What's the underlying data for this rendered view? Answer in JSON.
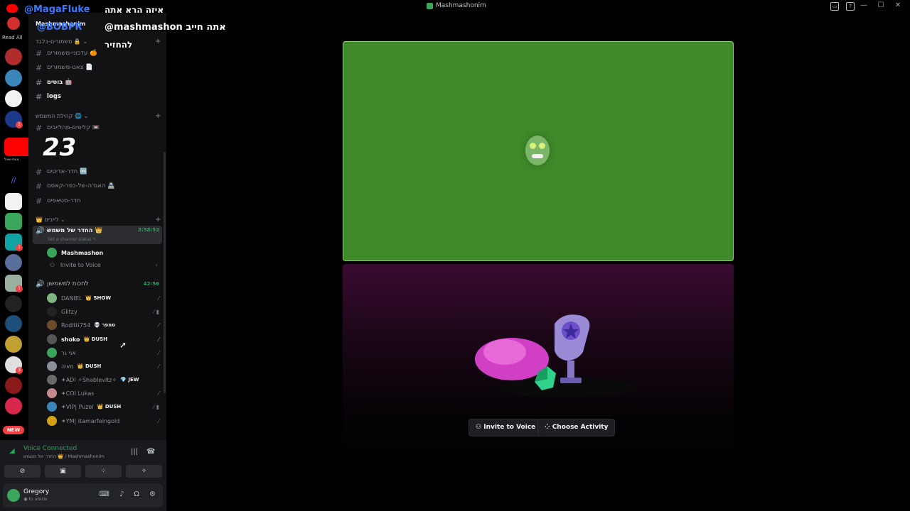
{
  "window": {
    "title": "Mashmashonim"
  },
  "overlay": {
    "line1": "איזה הרא אתה",
    "line2": "@mashmashon אתה חייב",
    "line3": "להחזיר",
    "twitter_handle": "@MagaFluke",
    "twitter_handle2": "@BOBPR",
    "big_number": "23"
  },
  "guilds": {
    "read_all": "Read All",
    "new_badge": "NEW",
    "yt_label": "צוות-שאל"
  },
  "server": {
    "name": "Mashmashonim"
  },
  "categories": [
    {
      "label": "משמורים-בלבד 🔒"
    },
    {
      "label": "קהילת המשמש 🌐"
    },
    {
      "label": "לייבים"
    }
  ],
  "channels": [
    {
      "label": "עדכוני-משמורים 🍊"
    },
    {
      "label": "צאט-משמורים 📄"
    },
    {
      "label": "בוטים 🤖"
    },
    {
      "label": "logs"
    },
    {
      "label": "קליפים-מהלייבים 📼"
    },
    {
      "label": "חדר-אדיטים 🆒"
    },
    {
      "label": "האגדה-של-כפר-קאסם 🏯"
    },
    {
      "label": "חדר-סטאפים"
    }
  ],
  "voice_channels": [
    {
      "label": "החדר של משמש 👑",
      "time": "3:58:52",
      "status": "Set a channel status"
    },
    {
      "label": "לחכות למשמשון",
      "time": "42:56"
    }
  ],
  "voice_members_1": [
    {
      "name": "Mashmashon"
    }
  ],
  "invite_label": "Invite to Voice",
  "voice_members_2": [
    {
      "name": "DANIEL",
      "tag": "👑 SHOW"
    },
    {
      "name": "Glitzy",
      "tag": ""
    },
    {
      "name": "Roditti754",
      "tag": "💀 סמפר"
    },
    {
      "name": "shoko",
      "tag": "👑 DUSH"
    },
    {
      "name": "אני גר",
      "tag": ""
    },
    {
      "name": "מאיה",
      "tag": "👑 DUSH"
    },
    {
      "name": "✦ADI ✧Shablevitz✧",
      "tag": "💎 JEW"
    },
    {
      "name": "✦COI Lukas",
      "tag": ""
    },
    {
      "name": "✦VIP| Puzel",
      "tag": "👑 DUSH"
    },
    {
      "name": "✦YM| itamarfeingold",
      "tag": ""
    }
  ],
  "voice_panel": {
    "connected": "Voice Connected",
    "channel_path": "החדר של משמש 👑 / Mashmashonim"
  },
  "user": {
    "name": "Gregory",
    "status": "In voice"
  },
  "stage": {
    "invite_button": "Invite to Voice",
    "activity_button": "Choose Activity"
  },
  "colors": {
    "accent_green": "#23a55a",
    "tile_green": "#3f8a2a",
    "danger": "#f23f43"
  }
}
